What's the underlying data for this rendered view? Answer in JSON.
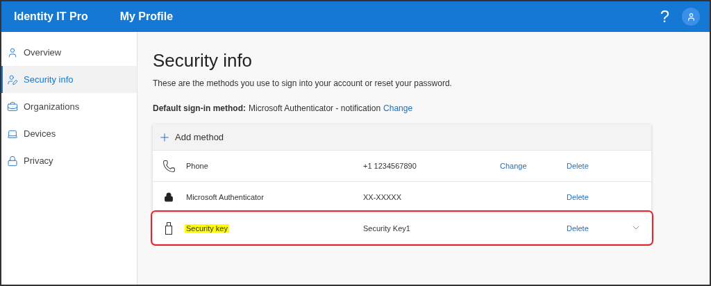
{
  "header": {
    "org": "Identity IT Pro",
    "app": "My Profile",
    "help": "?"
  },
  "sidebar": {
    "items": [
      {
        "label": "Overview",
        "selected": false
      },
      {
        "label": "Security info",
        "selected": true
      },
      {
        "label": "Organizations",
        "selected": false
      },
      {
        "label": "Devices",
        "selected": false
      },
      {
        "label": "Privacy",
        "selected": false
      }
    ]
  },
  "page": {
    "title": "Security info",
    "description": "These are the methods you use to sign into your account or reset your password.",
    "default_label": "Default sign-in method:",
    "default_value": "Microsoft Authenticator - notification",
    "default_change": "Change"
  },
  "methods_table": {
    "add_label": "Add method",
    "rows": [
      {
        "kind": "phone",
        "name": "Phone",
        "detail": "+1 1234567890",
        "change": "Change",
        "delete": "Delete",
        "highlighted": false,
        "outlined": false,
        "expandable": false
      },
      {
        "kind": "authenticator",
        "name": "Microsoft Authenticator",
        "detail": "XX-XXXXX",
        "delete": "Delete",
        "highlighted": false,
        "outlined": false,
        "expandable": false
      },
      {
        "kind": "security_key",
        "name": "Security key",
        "detail": "Security Key1",
        "delete": "Delete",
        "highlighted": true,
        "outlined": true,
        "expandable": true
      }
    ]
  }
}
